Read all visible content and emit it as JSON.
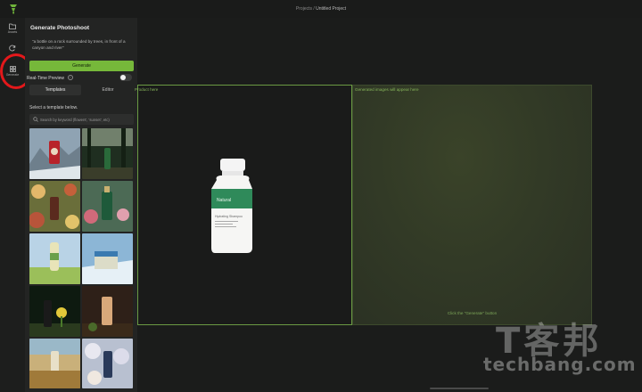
{
  "header": {
    "breadcrumb_parent": "Projects",
    "breadcrumb_sep": "/",
    "breadcrumb_current": "Untitled Project"
  },
  "rail": {
    "items": [
      {
        "label": "Assets",
        "icon": "folder-icon"
      },
      {
        "label": "",
        "icon": "refresh-icon"
      },
      {
        "label": "Generate",
        "icon": "grid-icon"
      }
    ]
  },
  "panel": {
    "title": "Generate Photoshoot",
    "prompt": "\"a bottle on a rock surrounded by trees, in front of a canyon and river\"",
    "generate_label": "Generate",
    "realtime_label": "Real-Time Preview",
    "realtime_on": false,
    "tabs": [
      {
        "label": "Templates",
        "active": true
      },
      {
        "label": "Editor",
        "active": false
      }
    ],
    "select_label": "Select a template below.",
    "search_placeholder": "Search by keyword (flowers', 'sunset', etc)"
  },
  "canvas": {
    "product_label": "Product here",
    "result_label": "Generated images will appear here",
    "click_hint": "Click the \"Generate\" button",
    "bottle_label": "Natural",
    "bottle_fine_print": "Hydrating Shampoo"
  },
  "watermark": {
    "cn": "T客邦",
    "en": "techbang.com"
  },
  "colors": {
    "accent": "#76b83a",
    "highlight": "#e3181b"
  }
}
